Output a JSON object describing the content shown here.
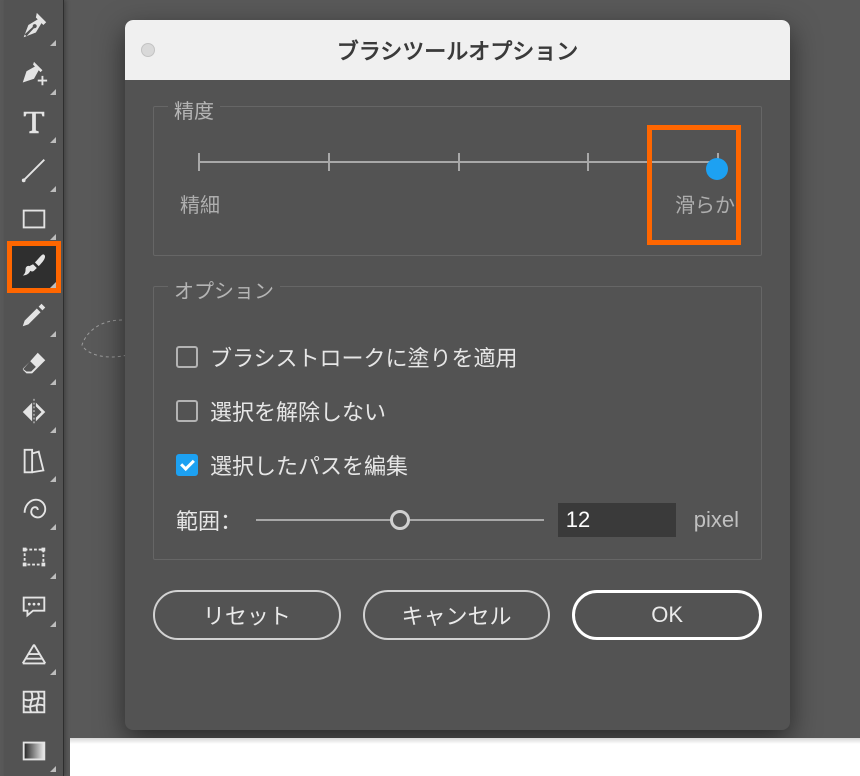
{
  "tools": {
    "pen": "pen-tool",
    "nib": "anchor-point-tool",
    "type": "type-tool",
    "line": "line-segment-tool",
    "rect": "rectangle-tool",
    "brush": "paintbrush-tool",
    "pencil": "pencil-tool",
    "eraser": "eraser-tool",
    "reflect": "reflect-tool",
    "swatch": "swatch-tool",
    "warp": "warp-tool",
    "freeTransform": "free-transform-tool",
    "comment": "comment-tool",
    "perspective": "perspective-grid-tool",
    "mesh": "mesh-tool",
    "gradient": "gradient-tool"
  },
  "dialog": {
    "title": "ブラシツールオプション"
  },
  "precision": {
    "legend": "精度",
    "min_label": "精細",
    "max_label": "滑らか",
    "ticks": 5,
    "value_index": 4
  },
  "options_group": {
    "legend": "オプション",
    "fill_option": {
      "checked": false,
      "label": "ブラシストロークに塗りを適用"
    },
    "keep_selected": {
      "checked": false,
      "label": "選択を解除しない"
    },
    "edit_selected": {
      "checked": true,
      "label": "選択したパスを編集"
    },
    "range_label": "範囲：",
    "range_value": "12",
    "range_unit": "pixel",
    "range_pos_pct": 50
  },
  "buttons": {
    "reset": "リセット",
    "cancel": "キャンセル",
    "ok": "OK"
  }
}
